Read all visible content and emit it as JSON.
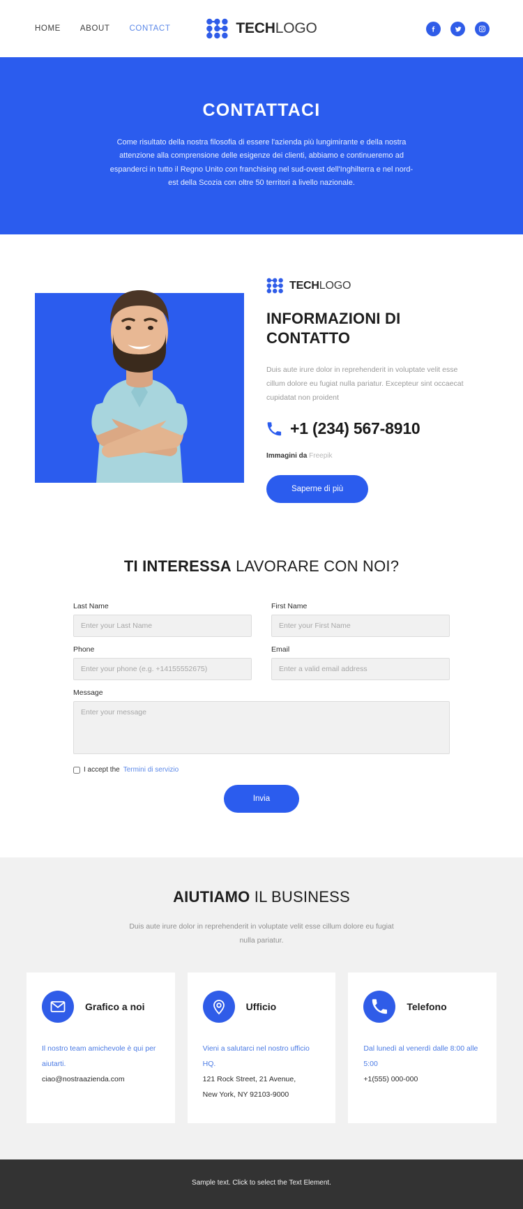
{
  "header": {
    "nav": [
      {
        "label": "HOME",
        "active": false
      },
      {
        "label": "ABOUT",
        "active": false
      },
      {
        "label": "CONTACT",
        "active": true
      }
    ],
    "logo": {
      "bold": "TECH",
      "light": "LOGO",
      "mark": "dot-grid-logo-icon"
    },
    "socials": [
      {
        "name": "facebook-icon"
      },
      {
        "name": "twitter-icon"
      },
      {
        "name": "instagram-icon"
      }
    ]
  },
  "hero": {
    "title": "CONTATTACI",
    "subtitle": "Come risultato della nostra filosofia di essere l'azienda più lungimirante e della nostra attenzione alla comprensione delle esigenze dei clienti, abbiamo e continueremo ad espanderci in tutto il Regno Unito con franchising nel sud-ovest dell'Inghilterra e nel nord-est della Scozia con oltre 50 territori a livello nazionale."
  },
  "info": {
    "logo": {
      "bold": "TECH",
      "light": "LOGO"
    },
    "title": "INFORMAZIONI DI CONTATTO",
    "text": "Duis aute irure dolor in reprehenderit in voluptate velit esse cillum dolore eu fugiat nulla pariatur. Excepteur sint occaecat cupidatat non proident",
    "phone": "+1 (234) 567-8910",
    "credit_prefix": "Immagini da",
    "credit_source": "Freepik",
    "button": "Saperne di più",
    "photo_alt": "smiling bearded man with crossed arms"
  },
  "form": {
    "heading_bold": "TI INTERESSA",
    "heading_light": " LAVORARE CON NOI?",
    "fields": {
      "last_name": {
        "label": "Last Name",
        "placeholder": "Enter your Last Name",
        "value": ""
      },
      "first_name": {
        "label": "First Name",
        "placeholder": "Enter your First Name",
        "value": ""
      },
      "phone": {
        "label": "Phone",
        "placeholder": "Enter your phone (e.g. +14155552675)",
        "value": ""
      },
      "email": {
        "label": "Email",
        "placeholder": "Enter a valid email address",
        "value": ""
      },
      "message": {
        "label": "Message",
        "placeholder": "Enter your message",
        "value": ""
      }
    },
    "accept_text": "I accept the",
    "accept_link": "Termini di servizio",
    "submit": "Invia"
  },
  "help": {
    "heading_bold": "AIUTIAMO",
    "heading_light": " IL BUSINESS",
    "subtitle": "Duis aute irure dolor in reprehenderit in voluptate velit esse cillum dolore eu fugiat nulla pariatur.",
    "cards": [
      {
        "icon": "envelope-icon",
        "title": "Grafico a noi",
        "blue_line": "Il nostro team amichevole è qui per aiutarti.",
        "dark_line": "ciao@nostraazienda.com",
        "dark_line2": ""
      },
      {
        "icon": "location-pin-icon",
        "title": "Ufficio",
        "blue_line": "Vieni a salutarci nel nostro ufficio HQ.",
        "dark_line": "121 Rock Street, 21 Avenue,",
        "dark_line2": "New York, NY 92103-9000"
      },
      {
        "icon": "phone-icon",
        "title": "Telefono",
        "blue_line": "Dal lunedì al venerdì dalle 8:00 alle 5:00",
        "dark_line": "+1(555) 000-000",
        "dark_line2": ""
      }
    ]
  },
  "footer": {
    "text": "Sample text. Click to select the Text Element."
  },
  "colors": {
    "brand_blue": "#2b5cee",
    "icon_blue": "#2f5ce8",
    "link_blue": "#5b88e8",
    "footer_dark": "#333333",
    "section_gray": "#f1f1f1"
  }
}
